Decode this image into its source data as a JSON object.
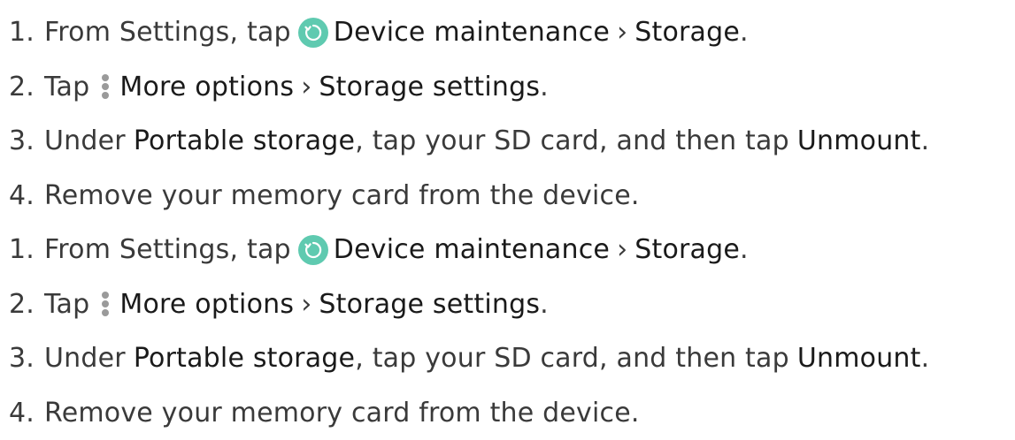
{
  "colors": {
    "text": "#3a3a3a",
    "bold": "#1a1a1a",
    "maintenance_icon": "#5fcab0",
    "more_icon": "#9a9a9a"
  },
  "icons": {
    "maintenance": "device-maintenance-icon",
    "more": "more-options-icon"
  },
  "blocks": [
    {
      "steps": [
        {
          "num": "1.",
          "a": "From Settings, tap",
          "b": "Device maintenance",
          "sep": "›",
          "c": "Storage",
          "end": "."
        },
        {
          "num": "2.",
          "a": "Tap",
          "b": "More options",
          "sep": "›",
          "c": "Storage settings",
          "end": "."
        },
        {
          "num": "3.",
          "a": "Under",
          "b": "Portable storage",
          "mid": ", tap your SD card, and then tap",
          "c": "Unmount",
          "end": "."
        },
        {
          "num": "4.",
          "a": "Remove your memory card from the device."
        }
      ]
    },
    {
      "steps": [
        {
          "num": "1.",
          "a": "From Settings, tap",
          "b": "Device maintenance",
          "sep": "›",
          "c": "Storage",
          "end": "."
        },
        {
          "num": "2.",
          "a": "Tap",
          "b": "More options",
          "sep": "›",
          "c": "Storage settings",
          "end": "."
        },
        {
          "num": "3.",
          "a": "Under",
          "b": "Portable storage",
          "mid": ", tap your SD card, and then tap",
          "c": "Unmount",
          "end": "."
        },
        {
          "num": "4.",
          "a": "Remove your memory card from the device."
        }
      ]
    }
  ]
}
